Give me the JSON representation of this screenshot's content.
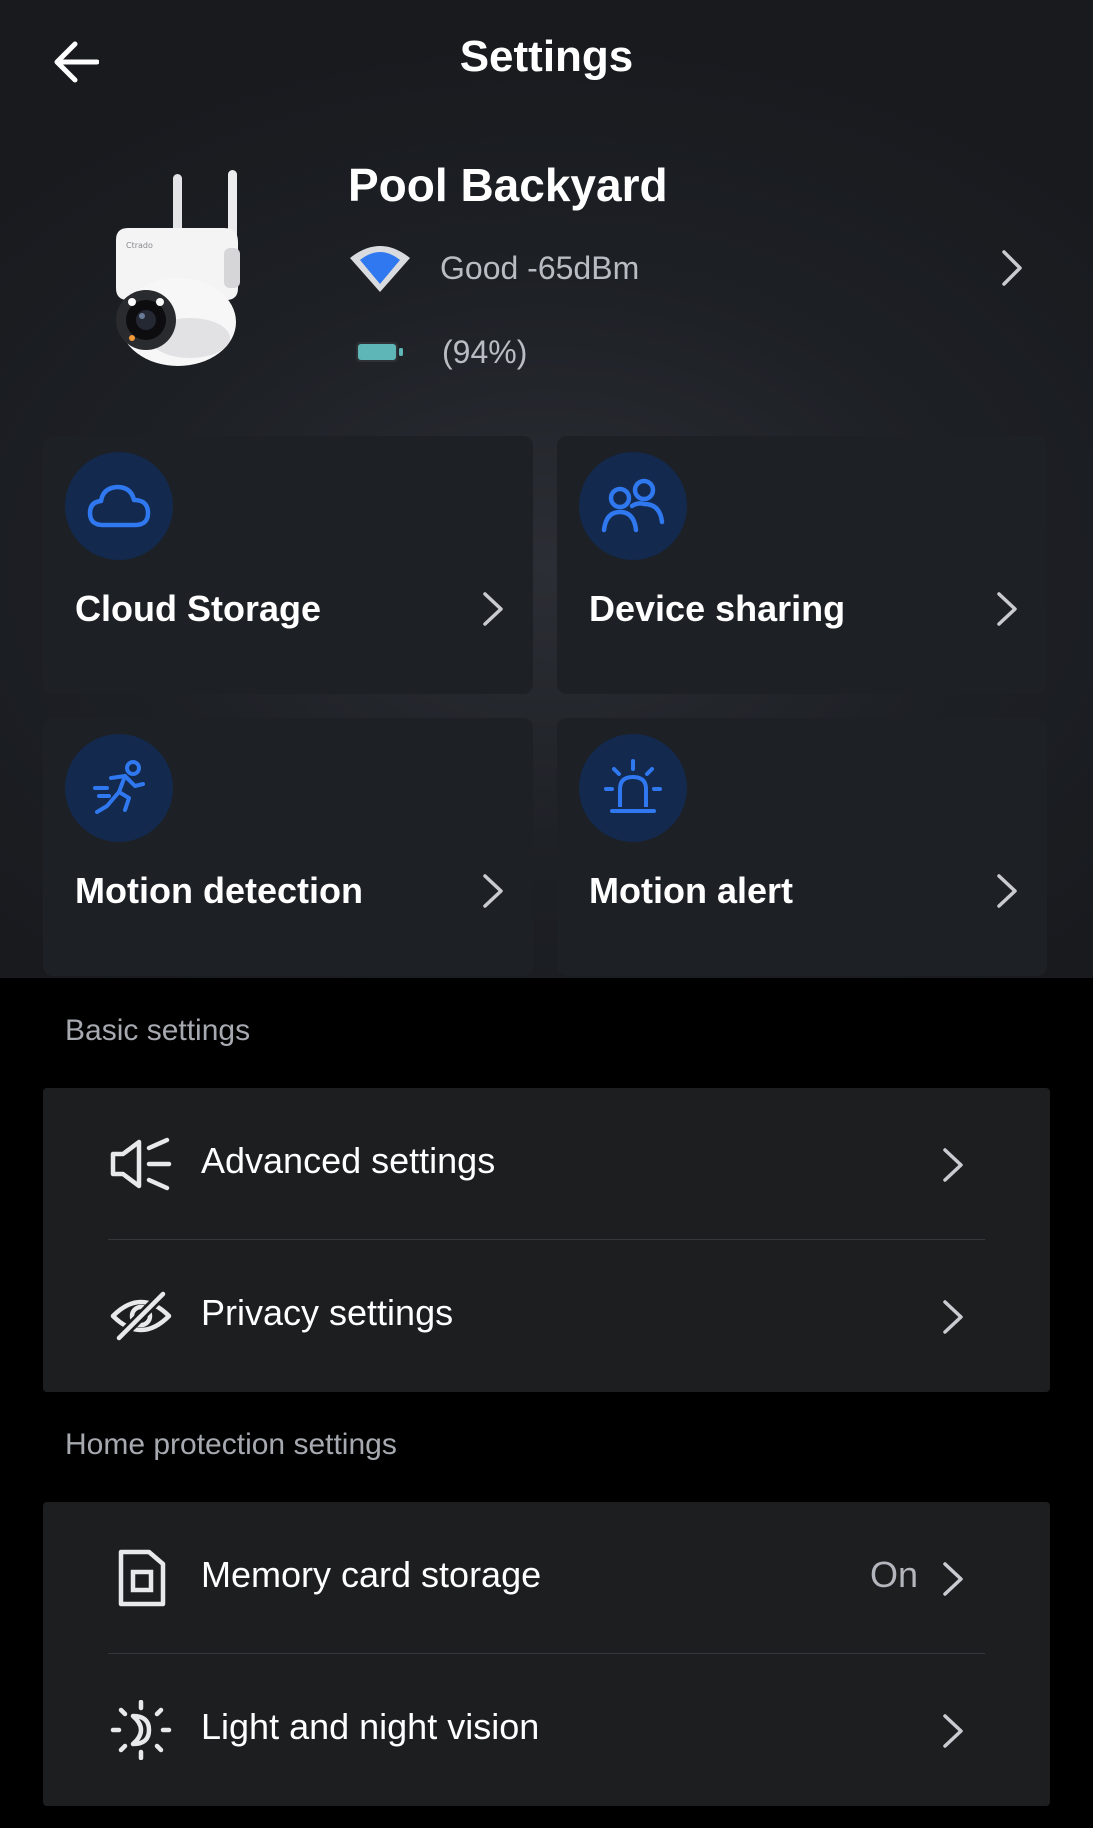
{
  "header": {
    "title": "Settings",
    "back_icon": "arrow-left-icon"
  },
  "device": {
    "name": "Pool Backyard",
    "wifi_text": "Good -65dBm",
    "battery_text": "(94%)",
    "battery_level": 0.94,
    "icons": {
      "wifi": "wifi-icon",
      "battery": "battery-icon",
      "chevron": "chevron-right-icon",
      "image": "security-camera-image"
    }
  },
  "tiles": [
    {
      "label": "Cloud Storage",
      "icon": "cloud-icon"
    },
    {
      "label": "Device sharing",
      "icon": "users-icon"
    },
    {
      "label": "Motion detection",
      "icon": "running-person-icon"
    },
    {
      "label": "Motion alert",
      "icon": "alarm-light-icon"
    }
  ],
  "sections": [
    {
      "title": "Basic settings",
      "items": [
        {
          "label": "Advanced settings",
          "value": "",
          "icon": "speaker-settings-icon"
        },
        {
          "label": "Privacy settings",
          "value": "",
          "icon": "eye-slash-icon"
        }
      ]
    },
    {
      "title": "Home protection settings",
      "items": [
        {
          "label": "Memory card storage",
          "value": "On",
          "icon": "sd-card-icon"
        },
        {
          "label": "Light and night vision",
          "value": "",
          "icon": "sun-moon-icon"
        }
      ]
    }
  ],
  "colors": {
    "background": "#000000",
    "panel": "#1d2025",
    "list_panel": "#1d1e20",
    "icon_circle": "#13294d",
    "accent_blue": "#2f78f0",
    "battery": "#5fb6b6",
    "secondary_text": "#b9bcc2"
  }
}
